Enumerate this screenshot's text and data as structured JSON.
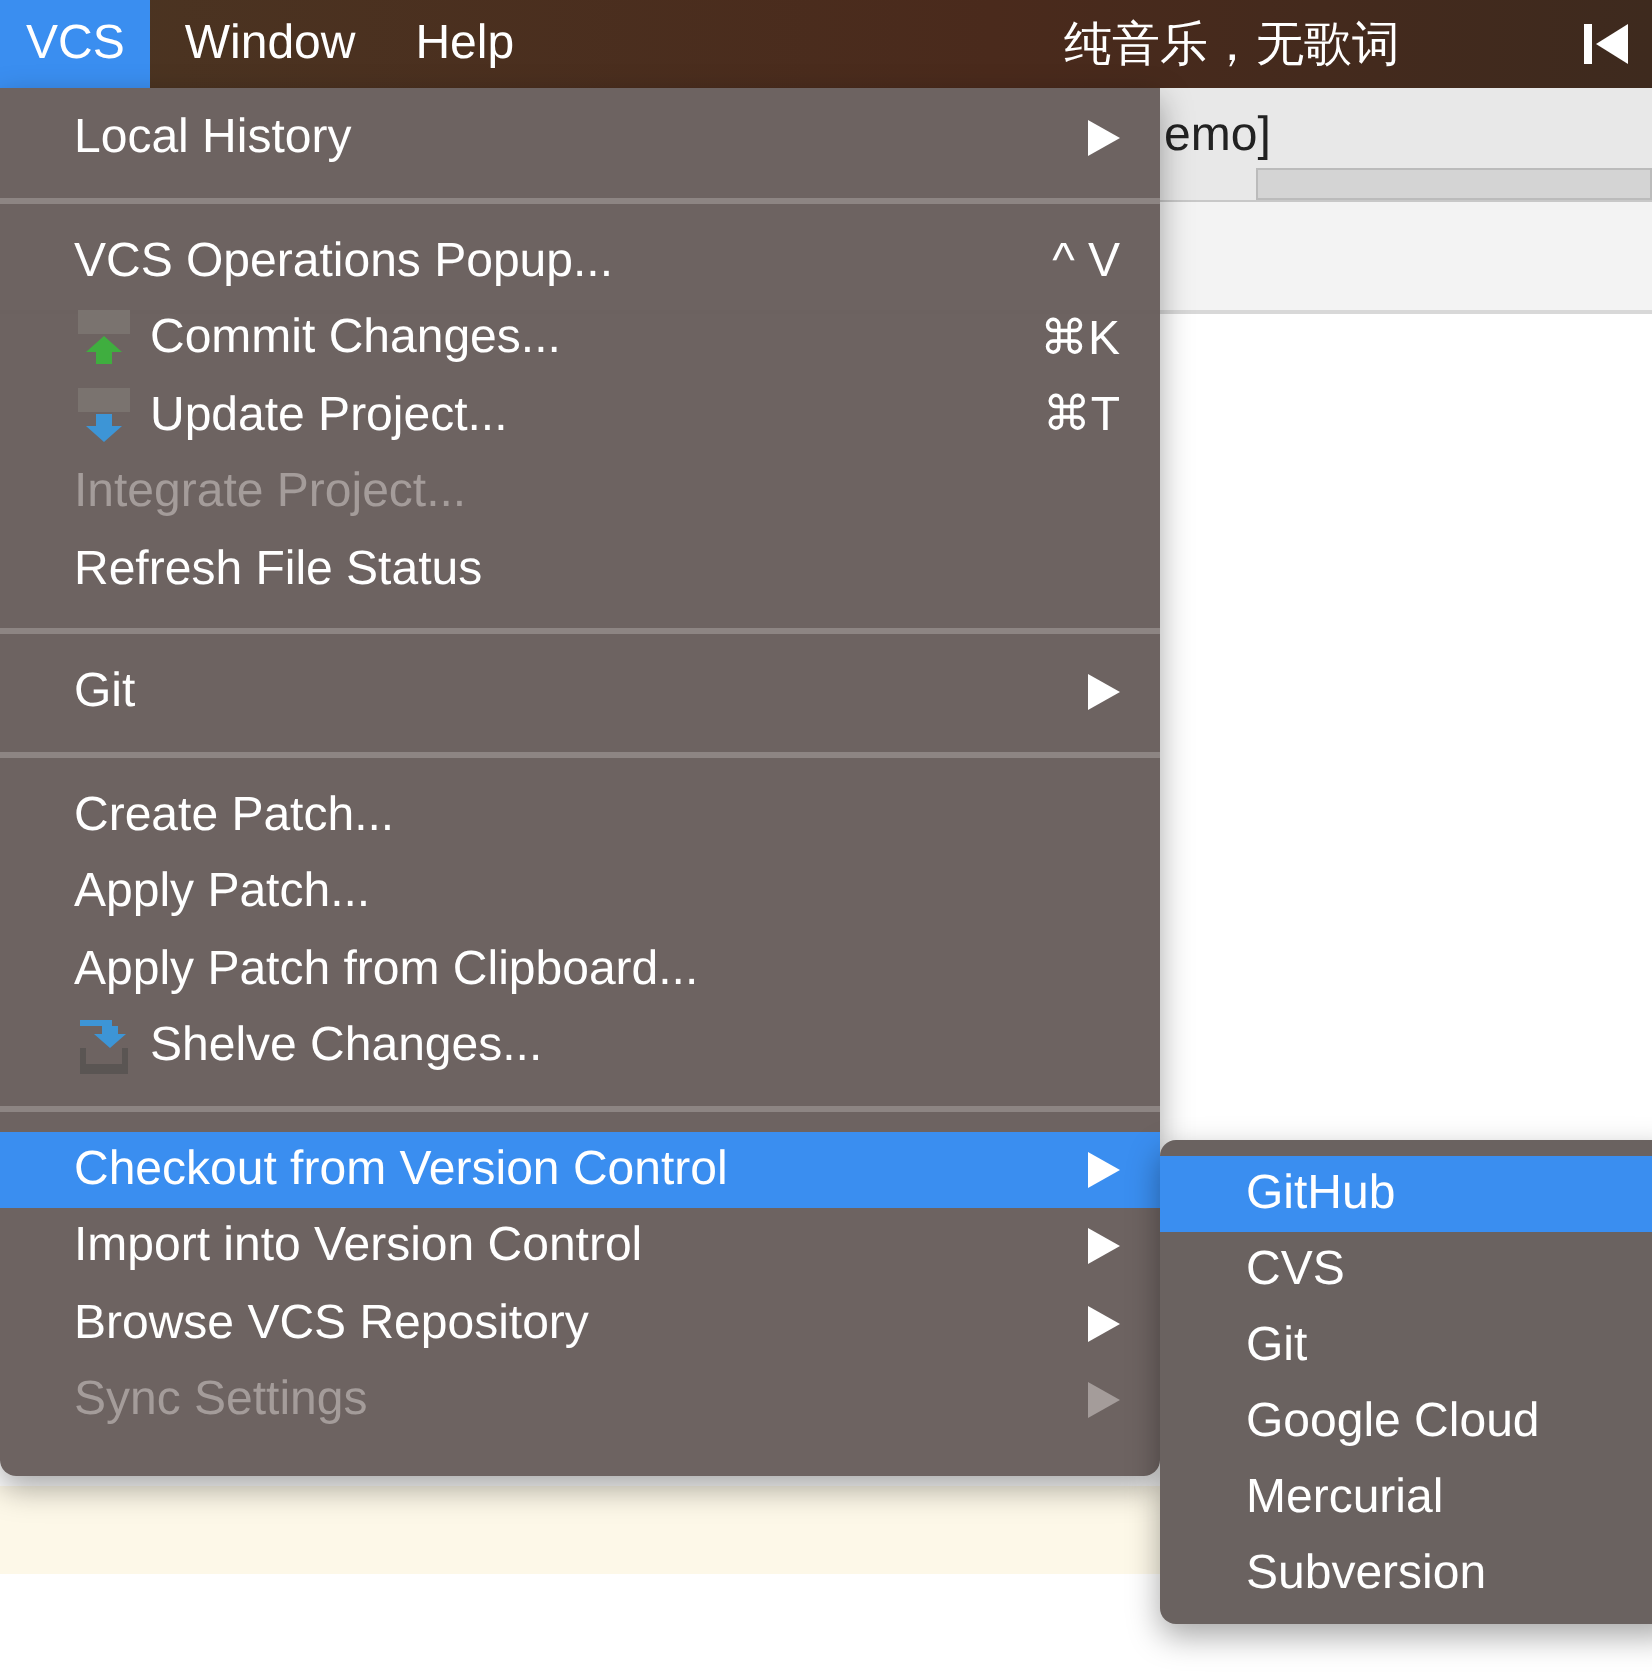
{
  "menubar": {
    "items": [
      {
        "label": "VCS",
        "selected": true
      },
      {
        "label": "Window",
        "selected": false
      },
      {
        "label": "Help",
        "selected": false
      }
    ],
    "now_playing": "纯音乐，无歌词"
  },
  "background": {
    "title_fragment": "emo]"
  },
  "menu": {
    "sections": [
      [
        {
          "label": "Local History",
          "kind": "plain",
          "submenu": true,
          "disabled": false,
          "selected": false
        }
      ],
      [
        {
          "label": "VCS Operations Popup...",
          "shortcut": "^ V",
          "kind": "plain",
          "submenu": false,
          "disabled": false,
          "selected": false
        },
        {
          "label": "Commit Changes...",
          "shortcut": "⌘K",
          "kind": "commit",
          "submenu": false,
          "disabled": false,
          "selected": false
        },
        {
          "label": "Update Project...",
          "shortcut": "⌘T",
          "kind": "update",
          "submenu": false,
          "disabled": false,
          "selected": false
        },
        {
          "label": "Integrate Project...",
          "kind": "plain",
          "submenu": false,
          "disabled": true,
          "selected": false
        },
        {
          "label": "Refresh File Status",
          "kind": "plain",
          "submenu": false,
          "disabled": false,
          "selected": false
        }
      ],
      [
        {
          "label": "Git",
          "kind": "plain",
          "submenu": true,
          "disabled": false,
          "selected": false
        }
      ],
      [
        {
          "label": "Create Patch...",
          "kind": "plain",
          "submenu": false,
          "disabled": false,
          "selected": false
        },
        {
          "label": "Apply Patch...",
          "kind": "plain",
          "submenu": false,
          "disabled": false,
          "selected": false
        },
        {
          "label": "Apply Patch from Clipboard...",
          "kind": "plain",
          "submenu": false,
          "disabled": false,
          "selected": false
        },
        {
          "label": "Shelve Changes...",
          "kind": "shelve",
          "submenu": false,
          "disabled": false,
          "selected": false
        }
      ],
      [
        {
          "label": "Checkout from Version Control",
          "kind": "plain",
          "submenu": true,
          "disabled": false,
          "selected": true
        },
        {
          "label": "Import into Version Control",
          "kind": "plain",
          "submenu": true,
          "disabled": false,
          "selected": false
        },
        {
          "label": "Browse VCS Repository",
          "kind": "plain",
          "submenu": true,
          "disabled": false,
          "selected": false
        },
        {
          "label": "Sync Settings",
          "kind": "plain",
          "submenu": true,
          "disabled": true,
          "selected": false
        }
      ]
    ]
  },
  "submenu": {
    "items": [
      {
        "label": "GitHub",
        "selected": true
      },
      {
        "label": "CVS",
        "selected": false
      },
      {
        "label": "Git",
        "selected": false
      },
      {
        "label": "Google Cloud",
        "selected": false
      },
      {
        "label": "Mercurial",
        "selected": false
      },
      {
        "label": "Subversion",
        "selected": false
      }
    ]
  }
}
